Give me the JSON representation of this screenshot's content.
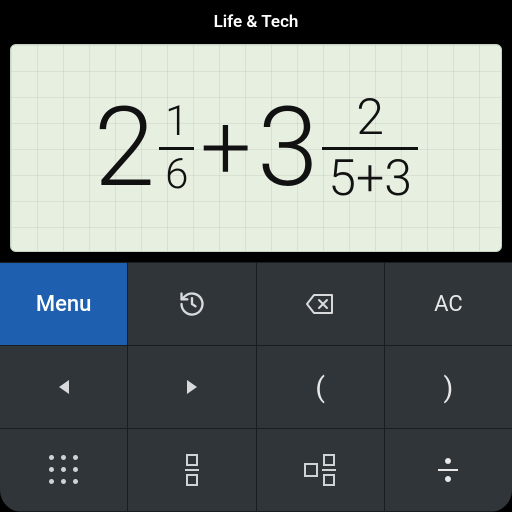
{
  "title": "Life & Tech",
  "expression": {
    "terms": [
      {
        "whole": "2",
        "numerator": "1",
        "denominator": "6"
      },
      {
        "operator": "+"
      },
      {
        "whole": "3",
        "numerator": "2",
        "denominator": "5+3"
      }
    ]
  },
  "keypad": {
    "row1": {
      "menu": "Menu",
      "history_icon": "history-icon",
      "backspace_icon": "backspace-icon",
      "ac": "AC"
    },
    "row2": {
      "left_icon": "cursor-left-icon",
      "right_icon": "cursor-right-icon",
      "paren_open": "(",
      "paren_close": ")"
    },
    "row3": {
      "keypad_toggle_icon": "keypad-grid-icon",
      "simple_fraction_icon": "simple-fraction-icon",
      "mixed_fraction_icon": "mixed-fraction-icon",
      "divide_icon": "divide-icon"
    }
  }
}
